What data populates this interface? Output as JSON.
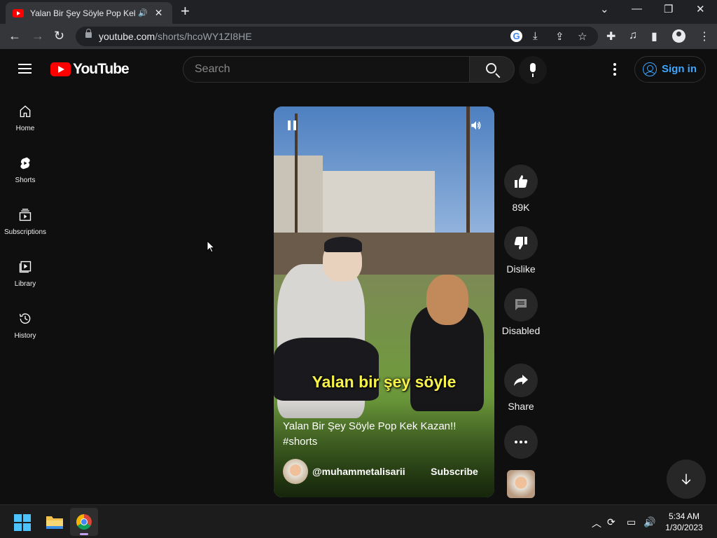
{
  "browser": {
    "tab_title": "Yalan Bir Şey Söyle Pop Kek Kazan!! #shorts",
    "url_host": "youtube.com",
    "url_path": "/shorts/hcoWY1ZI8HE"
  },
  "header": {
    "brand": "YouTube",
    "search_placeholder": "Search",
    "signin_label": "Sign in"
  },
  "sidebar": {
    "items": [
      {
        "label": "Home"
      },
      {
        "label": "Shorts"
      },
      {
        "label": "Subscriptions"
      },
      {
        "label": "Library"
      },
      {
        "label": "History"
      }
    ]
  },
  "short": {
    "caption": "Yalan bir şey söyle",
    "title": "Yalan Bir Şey Söyle Pop Kek Kazan!! #shorts",
    "channel": "@muhammetalisarii",
    "subscribe_label": "Subscribe"
  },
  "actions": {
    "like_count": "89K",
    "dislike_label": "Dislike",
    "comments_label": "Disabled",
    "share_label": "Share"
  },
  "taskbar": {
    "time": "5:34 AM",
    "date": "1/30/2023"
  },
  "colors": {
    "accent_blue": "#3ea6ff",
    "youtube_red": "#ff0000",
    "caption_yellow": "#f7f24a"
  }
}
